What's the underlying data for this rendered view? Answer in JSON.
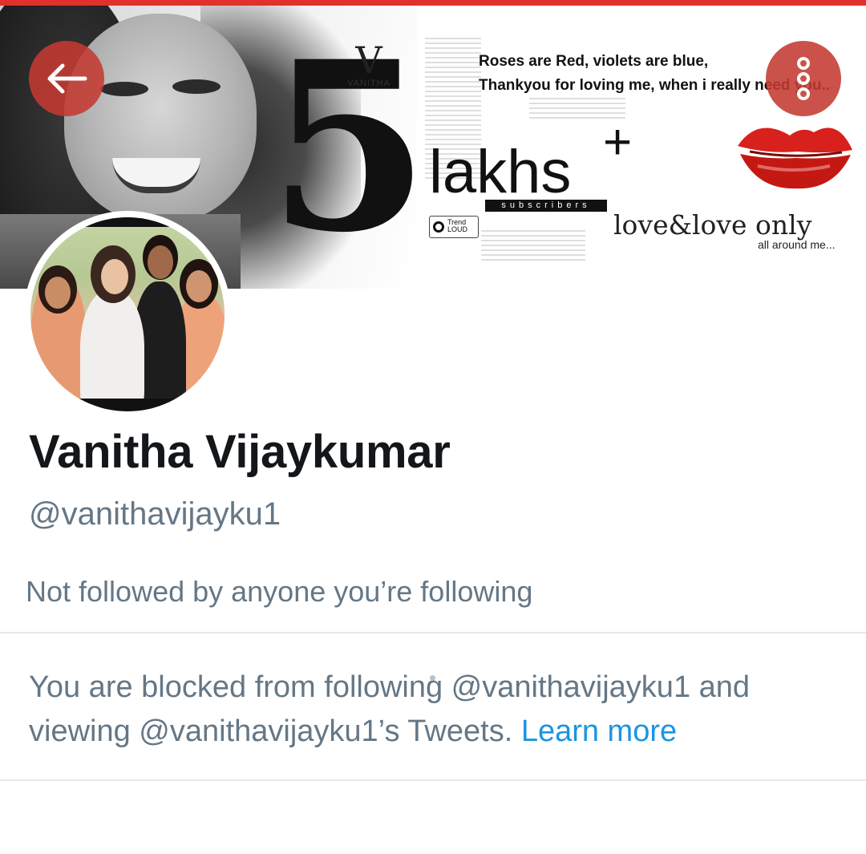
{
  "colors": {
    "top_stripe": "#e0312a",
    "overlay_button": "#c43a32",
    "secondary_text": "#657786",
    "link": "#1b95e0",
    "divider": "#e1e8ed"
  },
  "banner": {
    "big_number": "5",
    "brand": "VANITHA",
    "lakhs": "lakhs",
    "plus": "+",
    "subscribers": "subscribers",
    "trend_badge": "Trend LOUD",
    "poem_line_1": "Roses are Red, violets are blue,",
    "poem_line_2": "Thankyou for loving me, when i really need you..",
    "love_line": "love&love only",
    "around_line": "all around me..."
  },
  "nav": {
    "back_icon": "arrow-left-icon",
    "more_icon": "more-vertical-icon"
  },
  "profile": {
    "display_name": "Vanitha Vijaykumar",
    "handle": "@vanithavijayku1",
    "followed_note": "Not followed by anyone you’re following",
    "blocked_text": "You are blocked from following @vanithavijayku1 and viewing @vanithavijayku1’s Tweets.",
    "learn_more": "Learn more"
  }
}
